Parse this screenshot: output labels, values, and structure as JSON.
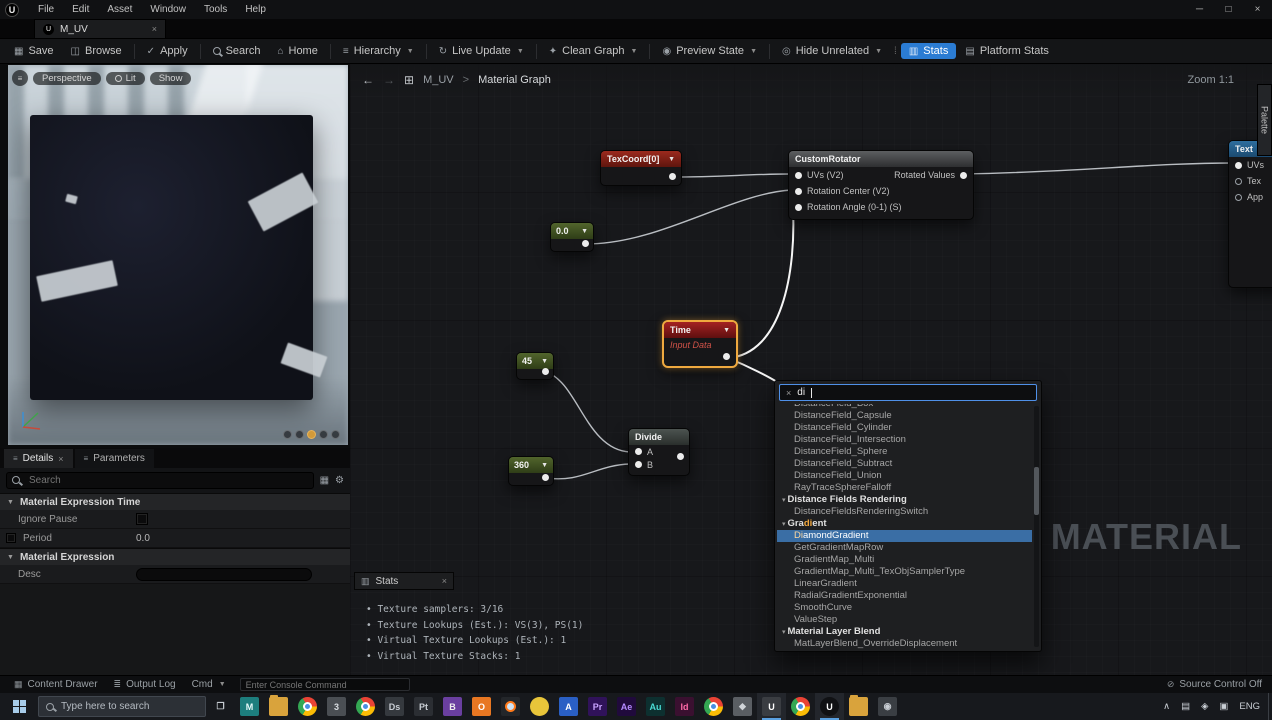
{
  "colors": {
    "accent_blue": "#2b7cd3",
    "selection_orange": "#efa93f",
    "popup_selection": "#3a6ea5",
    "wire_selected": "#f5f5f5",
    "node_header_red": "#9b2a1e",
    "node_header_green": "#51652c",
    "taskbar_active_indicator": "#5aa0e0"
  },
  "window_menu": {
    "items": [
      "File",
      "Edit",
      "Asset",
      "Window",
      "Tools",
      "Help"
    ]
  },
  "tab": {
    "label": "M_UV"
  },
  "toolbar": {
    "save": "Save",
    "browse": "Browse",
    "apply": "Apply",
    "search": "Search",
    "home": "Home",
    "hierarchy": "Hierarchy",
    "live_update": "Live Update",
    "clean_graph": "Clean Graph",
    "preview_state": "Preview State",
    "hide_unrelated": "Hide Unrelated",
    "stats": "Stats",
    "platform_stats": "Platform Stats"
  },
  "viewport": {
    "perspective": "Perspective",
    "lit": "Lit",
    "show": "Show"
  },
  "details": {
    "tab_details": "Details",
    "tab_parameters": "Parameters",
    "search_placeholder": "Search",
    "section_time": "Material Expression Time",
    "ignore_pause": "Ignore Pause",
    "period": "Period",
    "period_value": "0.0",
    "section_expression": "Material Expression",
    "desc": "Desc"
  },
  "graph": {
    "crumb_parent": "M_UV",
    "crumb_sep": ">",
    "crumb_current": "Material Graph",
    "zoom": "Zoom 1:1",
    "palette": "Palette",
    "watermark": "MATERIAL",
    "nodes": {
      "texcoord": {
        "title": "TexCoord[0]"
      },
      "rotator": {
        "title": "CustomRotator",
        "in1": "UVs (V2)",
        "in2": "Rotation Center (V2)",
        "in3": "Rotation Angle (0-1) (S)",
        "out": "Rotated Values"
      },
      "const0": {
        "value": "0.0"
      },
      "time": {
        "title": "Time",
        "subtitle": "Input Data"
      },
      "const45": {
        "value": "45"
      },
      "divide": {
        "title": "Divide",
        "a": "A",
        "b": "B"
      },
      "const360": {
        "value": "360"
      },
      "texture": {
        "title": "Text",
        "p1": "UVs",
        "p2": "Tex",
        "p3": "App"
      }
    }
  },
  "popup": {
    "query": "di",
    "items": [
      {
        "pre": "DistanceField_Box",
        "hi": "",
        "post": "",
        "cls": "clip"
      },
      {
        "pre": "DistanceField_Capsule",
        "hi": "",
        "post": "",
        "cls": ""
      },
      {
        "pre": "DistanceField_Cylinder",
        "hi": "",
        "post": "",
        "cls": ""
      },
      {
        "pre": "DistanceField_Intersection",
        "hi": "",
        "post": "",
        "cls": ""
      },
      {
        "pre": "DistanceField_Sphere",
        "hi": "",
        "post": "",
        "cls": ""
      },
      {
        "pre": "DistanceField_Subtract",
        "hi": "",
        "post": "",
        "cls": ""
      },
      {
        "pre": "DistanceField_Union",
        "hi": "",
        "post": "",
        "cls": ""
      },
      {
        "pre": "RayTraceSphereFalloff",
        "hi": "",
        "post": "",
        "cls": ""
      },
      {
        "pre": "Distance Fields Rendering",
        "hi": "",
        "post": "",
        "cls": "cat"
      },
      {
        "pre": "DistanceFieldsRenderingSwitch",
        "hi": "",
        "post": "",
        "cls": ""
      },
      {
        "pre": "Gra",
        "hi": "di",
        "post": "ent",
        "cls": "cat"
      },
      {
        "pre": "",
        "hi": "Di",
        "post": "amondGradient",
        "cls": "sel"
      },
      {
        "pre": "GetGradientMapRow",
        "hi": "",
        "post": "",
        "cls": ""
      },
      {
        "pre": "GradientMap_Multi",
        "hi": "",
        "post": "",
        "cls": ""
      },
      {
        "pre": "GradientMap_Multi_TexObjSamplerType",
        "hi": "",
        "post": "",
        "cls": ""
      },
      {
        "pre": "LinearGradient",
        "hi": "",
        "post": "",
        "cls": ""
      },
      {
        "pre": "RadialGradientExponential",
        "hi": "",
        "post": "",
        "cls": ""
      },
      {
        "pre": "SmoothCurve",
        "hi": "",
        "post": "",
        "cls": ""
      },
      {
        "pre": "ValueStep",
        "hi": "",
        "post": "",
        "cls": ""
      },
      {
        "pre": "Material Layer Blend",
        "hi": "",
        "post": "",
        "cls": "cat"
      },
      {
        "pre": "MatLayerBlend_OverrideDisplacement",
        "hi": "",
        "post": "",
        "cls": ""
      }
    ]
  },
  "stats_panel": {
    "title": "Stats",
    "lines": [
      "Texture samplers: 3/16",
      "Texture Lookups (Est.): VS(3), PS(1)",
      "Virtual Texture Lookups (Est.): 1",
      "Virtual Texture Stacks: 1"
    ]
  },
  "statusbar": {
    "content_drawer": "Content Drawer",
    "output_log": "Output Log",
    "cmd": "Cmd",
    "console_placeholder": "Enter Console Command",
    "source_control": "Source Control Off"
  },
  "taskbar": {
    "search_placeholder": "Type here to search",
    "icons": [
      {
        "label": "❐",
        "bg": "transparent",
        "fg": "#c9ced4",
        "ic": "",
        "cc": ""
      },
      {
        "label": "M",
        "bg": "#1d7e7e",
        "fg": "#e8fbfb",
        "ic": "",
        "cc": ""
      },
      {
        "label": "",
        "ic": "shape-folder",
        "cc": ""
      },
      {
        "label": "",
        "ic": "shape-chrome",
        "cc": ""
      },
      {
        "label": "3",
        "bg": "#4a4e53",
        "fg": "#d9dde1",
        "ic": "",
        "cc": ""
      },
      {
        "label": "",
        "ic": "shape-chrome",
        "cc": ""
      },
      {
        "label": "Ds",
        "bg": "#35393e",
        "fg": "#c9ced4",
        "ic": "",
        "cc": ""
      },
      {
        "label": "Pt",
        "bg": "#2b2e33",
        "fg": "#c9ced4",
        "ic": "",
        "cc": ""
      },
      {
        "label": "B",
        "bg": "#6a3fa0",
        "fg": "#eeeeee",
        "ic": "",
        "cc": ""
      },
      {
        "label": "O",
        "bg": "#e87722",
        "fg": "#ffffff",
        "ic": "",
        "cc": ""
      },
      {
        "label": "",
        "ic": "shape-blender",
        "cc": ""
      },
      {
        "label": "",
        "bg": "#e8c53a",
        "ic": "shape-circle",
        "cc": ""
      },
      {
        "label": "A",
        "bg": "#2a5fc4",
        "fg": "#ffffff",
        "ic": "",
        "cc": ""
      },
      {
        "label": "Pr",
        "bg": "#30125a",
        "fg": "#c9a3ff",
        "ic": "",
        "cc": ""
      },
      {
        "label": "Ae",
        "bg": "#200a3c",
        "fg": "#b48aff",
        "ic": "",
        "cc": ""
      },
      {
        "label": "Au",
        "bg": "#0d3030",
        "fg": "#4adbd4",
        "ic": "",
        "cc": ""
      },
      {
        "label": "Id",
        "bg": "#3a1030",
        "fg": "#ff6aa8",
        "ic": "",
        "cc": ""
      },
      {
        "label": "",
        "ic": "shape-chrome",
        "cc": ""
      },
      {
        "label": "◆",
        "bg": "#5a5e63",
        "fg": "#d0d4d8",
        "ic": "",
        "cc": ""
      },
      {
        "label": "U",
        "bg": "#3a3d42",
        "fg": "#ffffff",
        "ic": "",
        "cc": "tb-active"
      },
      {
        "label": "",
        "ic": "shape-chrome",
        "cc": ""
      },
      {
        "label": "U",
        "bg": "#101114",
        "fg": "#ffffff",
        "ic": "shape-circle",
        "cc": "tb-active"
      },
      {
        "label": "",
        "ic": "shape-folder",
        "cc": ""
      },
      {
        "label": "◉",
        "bg": "#3a3e43",
        "fg": "#c9ced4",
        "ic": "",
        "cc": ""
      }
    ],
    "tray": [
      "∧",
      "▤",
      "◈",
      "▣",
      "ENG"
    ]
  }
}
